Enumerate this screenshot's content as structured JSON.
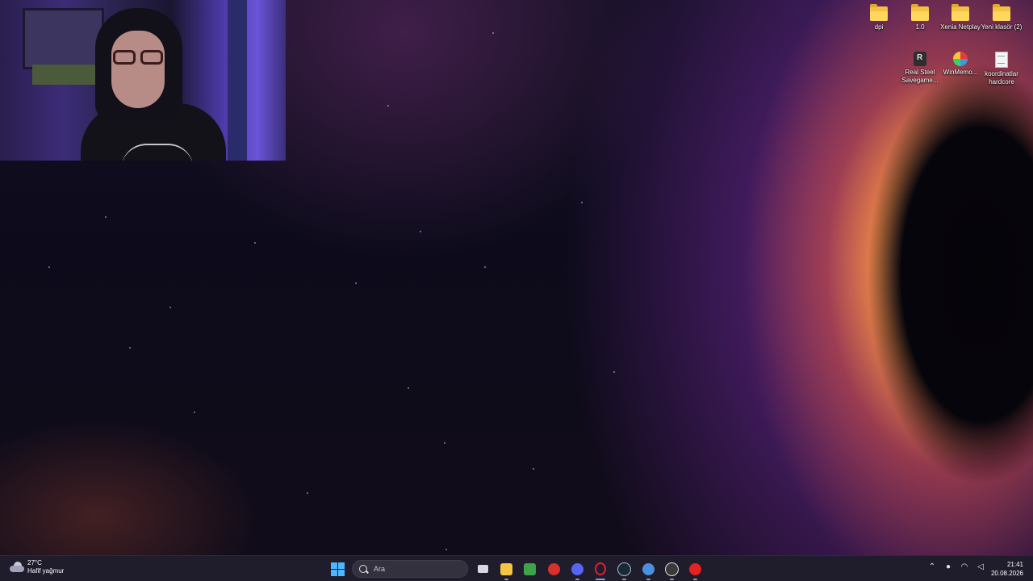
{
  "desktop": {
    "icons": [
      {
        "label": "dpi",
        "icon": "folder-icon"
      },
      {
        "label": "1.0",
        "icon": "folder-icon"
      },
      {
        "label": "Xenia Netplay",
        "icon": "folder-icon"
      },
      {
        "label": "Yeni klasör (2)",
        "icon": "folder-icon"
      },
      {
        "label": "Real Steel Savegame...",
        "icon": "game-shortcut-icon"
      },
      {
        "label": "WinMemo...",
        "icon": "winmemo-app-icon"
      },
      {
        "label": "koordinatlar hardcore",
        "icon": "text-document-icon"
      }
    ]
  },
  "taskbar": {
    "weather": {
      "temperature": "27°C",
      "condition": "Hafif yağmur"
    },
    "search_placeholder": "Ara",
    "apps": [
      {
        "name": "task-view",
        "color": "#d8d8e0"
      },
      {
        "name": "file-explorer",
        "color": "#f4c542"
      },
      {
        "name": "minecraft",
        "color": "#3ea34a"
      },
      {
        "name": "red-app",
        "color": "#d8312c"
      },
      {
        "name": "discord",
        "color": "#5865f2"
      },
      {
        "name": "opera",
        "color": "#e0202e"
      },
      {
        "name": "steam",
        "color": "#1b2838"
      },
      {
        "name": "settings-app",
        "color": "#4a90e2"
      },
      {
        "name": "obs",
        "color": "#3a3a3a"
      },
      {
        "name": "youtube-music",
        "color": "#e52222"
      }
    ],
    "clock": {
      "time": "21:41",
      "date": "20.08.2026"
    }
  },
  "colors": {
    "taskbar_bg": "#1f1c2b",
    "accent": "#4fb6ff"
  }
}
